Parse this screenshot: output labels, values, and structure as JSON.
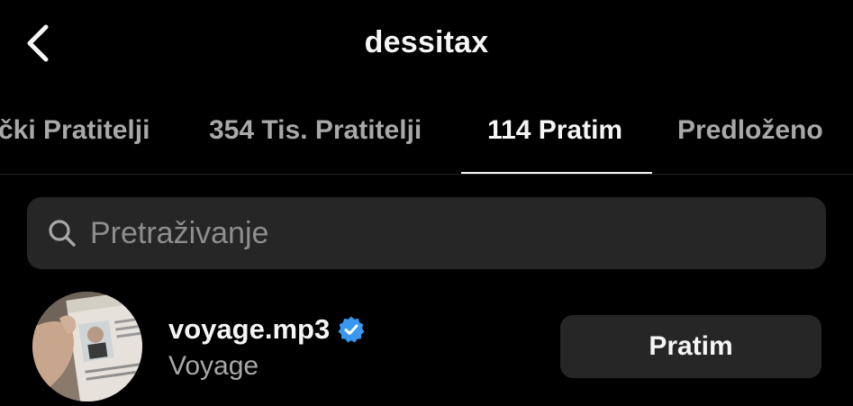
{
  "header": {
    "title": "dessitax",
    "back_icon": "chevron-left-icon"
  },
  "tabs": [
    {
      "label": "čki Pratitelji",
      "active": false
    },
    {
      "label": "354 Tis. Pratitelji",
      "active": false
    },
    {
      "label": "114 Pratim",
      "active": true
    },
    {
      "label": "Predloženo",
      "active": false
    }
  ],
  "search": {
    "placeholder": "Pretraživanje",
    "value": "",
    "icon": "search-icon"
  },
  "users": [
    {
      "username": "voyage.mp3",
      "full_name": "Voyage",
      "verified": true,
      "button_label": "Pratim"
    }
  ],
  "colors": {
    "background": "#000000",
    "surface": "#262626",
    "text_primary": "#f5f5f5",
    "text_secondary": "#a8a8a8",
    "verified_blue": "#3897f0"
  }
}
